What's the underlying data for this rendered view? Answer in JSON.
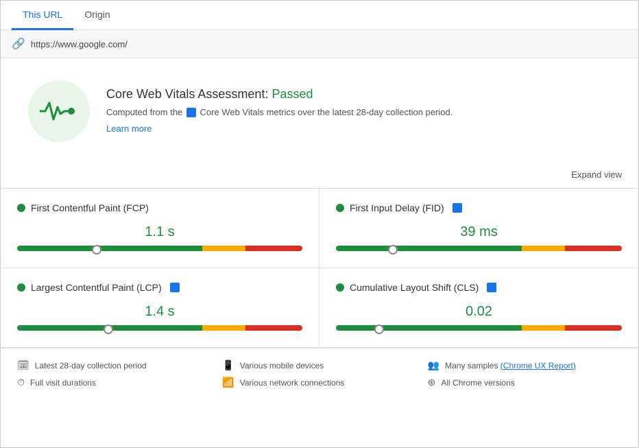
{
  "tabs": [
    {
      "id": "this-url",
      "label": "This URL",
      "active": true
    },
    {
      "id": "origin",
      "label": "Origin",
      "active": false
    }
  ],
  "url": "https://www.google.com/",
  "assessment": {
    "title_prefix": "Core Web Vitals Assessment: ",
    "status": "Passed",
    "description": "Computed from the",
    "description2": "Core Web Vitals metrics over the latest 28-day collection period.",
    "learn_more": "Learn more"
  },
  "expand_view": "Expand view",
  "metrics": [
    {
      "id": "fcp",
      "name": "First Contentful Paint (FCP)",
      "has_badge": false,
      "value": "1.1 s",
      "bar": {
        "green": 65,
        "yellow": 15,
        "red": 20,
        "marker_pct": 28
      }
    },
    {
      "id": "fid",
      "name": "First Input Delay (FID)",
      "has_badge": true,
      "value": "39 ms",
      "bar": {
        "green": 65,
        "yellow": 15,
        "red": 20,
        "marker_pct": 20
      }
    },
    {
      "id": "lcp",
      "name": "Largest Contentful Paint (LCP)",
      "has_badge": true,
      "value": "1.4 s",
      "bar": {
        "green": 65,
        "yellow": 15,
        "red": 20,
        "marker_pct": 32
      }
    },
    {
      "id": "cls",
      "name": "Cumulative Layout Shift (CLS)",
      "has_badge": true,
      "value": "0.02",
      "bar": {
        "green": 65,
        "yellow": 15,
        "red": 20,
        "marker_pct": 15
      }
    }
  ],
  "footer": [
    {
      "id": "collection-period",
      "icon": "calendar",
      "text": "Latest 28-day collection period"
    },
    {
      "id": "mobile-devices",
      "icon": "mobile",
      "text": "Various mobile devices"
    },
    {
      "id": "chrome-ux",
      "icon": "users",
      "text": "Many samples",
      "link_text": "Chrome UX Report",
      "has_link": true
    },
    {
      "id": "visit-durations",
      "icon": "timer",
      "text": "Full visit durations"
    },
    {
      "id": "network",
      "icon": "wifi",
      "text": "Various network connections"
    },
    {
      "id": "chrome-versions",
      "icon": "chrome",
      "text": "All Chrome versions"
    }
  ],
  "colors": {
    "accent": "#1a73e8",
    "pass": "#1e8e3e",
    "warn": "#f9ab00",
    "fail": "#d93025"
  }
}
